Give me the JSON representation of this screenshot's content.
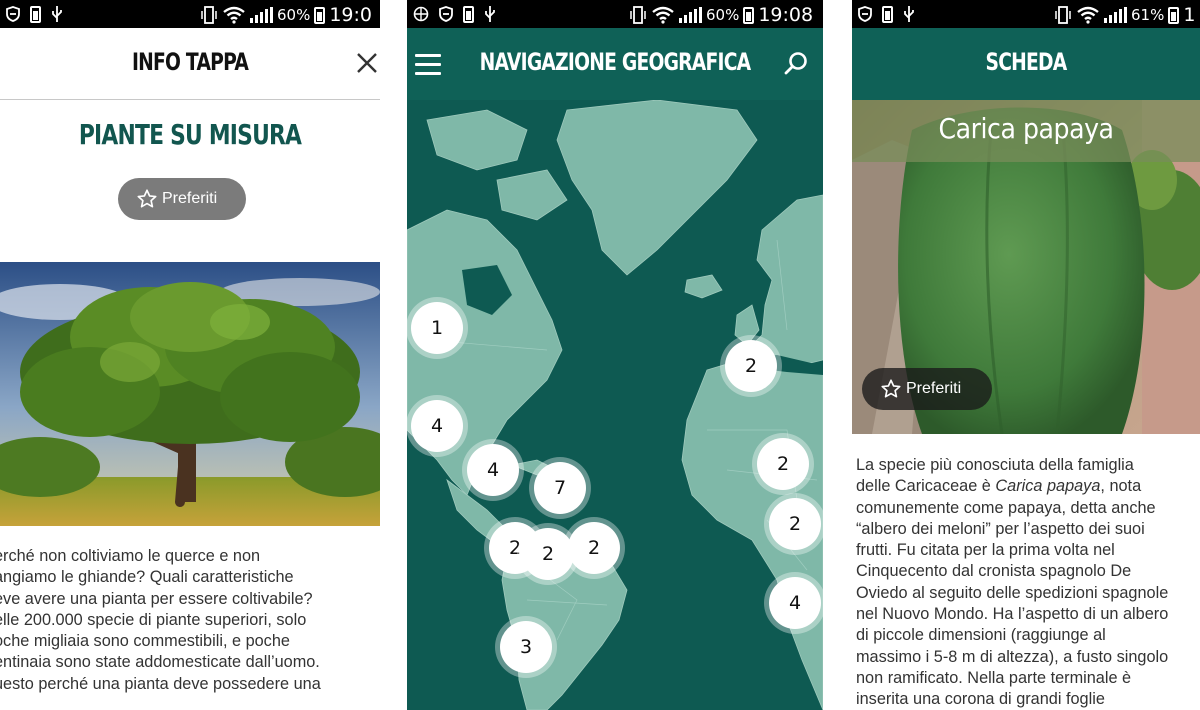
{
  "screen1": {
    "status": {
      "battery": "60%",
      "time": "19:0"
    },
    "header": {
      "title": "INFO TAPPA"
    },
    "title": "PIANTE SU MISURA",
    "favorites_label": "Preferiti",
    "body_lines": [
      "erché non coltiviamo le querce e non",
      "angiamo le ghiande? Quali caratteristiche",
      "eve avere una pianta per essere coltivabile?",
      "elle 200.000 specie di piante superiori, solo",
      "oche migliaia sono commestibili, e poche",
      "entinaia sono state addomesticate dall’uomo.",
      "uesto perché una pianta deve possedere una"
    ]
  },
  "screen2": {
    "status": {
      "battery": "60%",
      "time": "19:08"
    },
    "header": {
      "title": "NAVIGAZIONE GEOGRAFICA"
    },
    "clusters": [
      "1",
      "4",
      "4",
      "7",
      "2",
      "2",
      "2",
      "3",
      "2",
      "2",
      "2",
      "4"
    ]
  },
  "screen3": {
    "status": {
      "battery": "61%",
      "time": "1"
    },
    "header": {
      "title": "SCHEDA"
    },
    "plant_name": "Carica papaya",
    "favorites_label": "Preferiti",
    "body": {
      "line1": "La specie più conosciuta della famiglia",
      "line2_a": "delle Caricaceae è ",
      "line2_em": "Carica papaya",
      "line2_b": ", nota",
      "lines": [
        "comunemente come papaya, detta anche",
        "“albero dei meloni” per l’aspetto dei suoi",
        "frutti. Fu citata per la prima volta nel",
        "Cinquecento dal cronista spagnolo De",
        "Oviedo al seguito delle spedizioni spagnole",
        "nel Nuovo Mondo. Ha l’aspetto di un albero",
        "di piccole dimensioni (raggiunge al",
        "massimo i 5-8 m di altezza), a fusto singolo",
        "non ramificato. Nella parte terminale è",
        "inserita una corona di grandi foglie"
      ]
    }
  },
  "colors": {
    "brand_teal": "#0f6157",
    "map_ocean": "#0e5a52",
    "map_land": "#7fb8a8",
    "title_teal": "#12564f"
  }
}
